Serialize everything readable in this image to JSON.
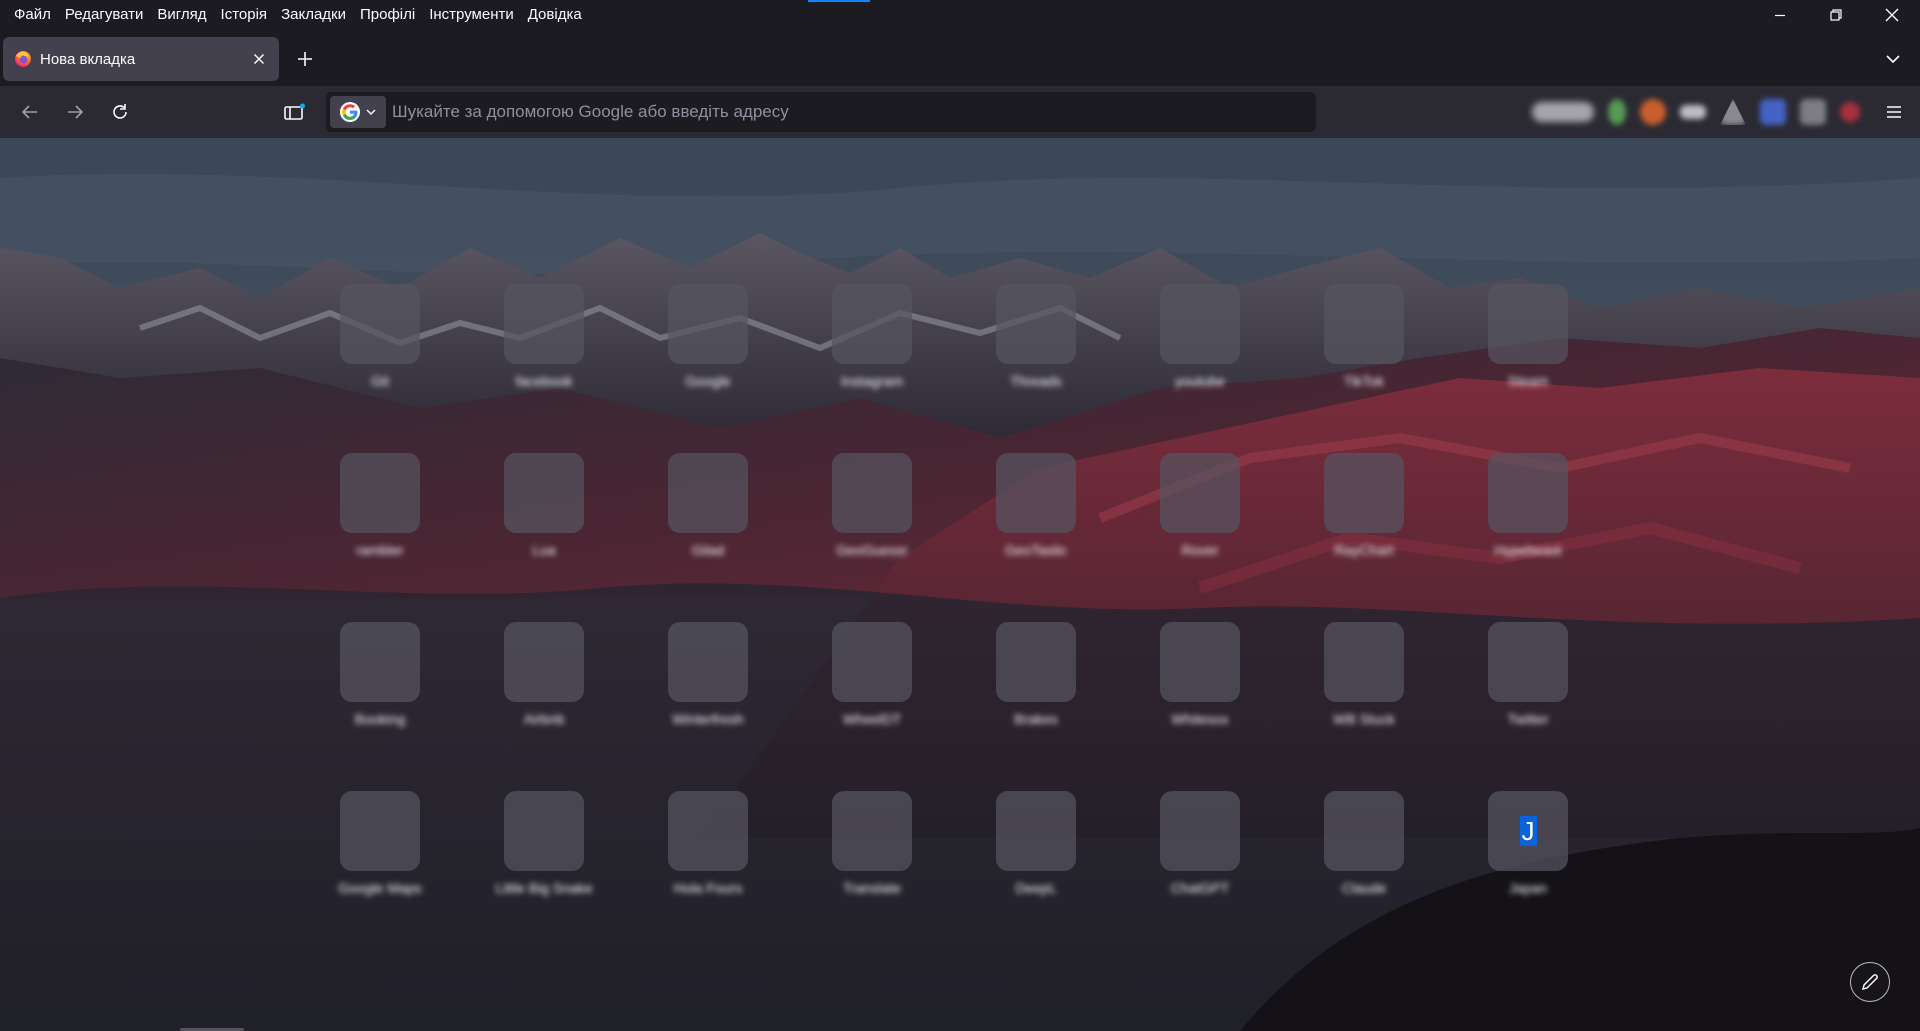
{
  "menu": {
    "items": [
      "Файл",
      "Редагувати",
      "Вигляд",
      "Історія",
      "Закладки",
      "Профілі",
      "Інструменти",
      "Довідка"
    ]
  },
  "window_controls": [
    "minimize-icon",
    "restore-icon",
    "close-icon"
  ],
  "tab": {
    "title": "Нова вкладка",
    "favicon": "firefox-icon"
  },
  "navbar": {
    "search_placeholder": "Шукайте за допомогою Google або введіть адресу",
    "engine": "google-icon",
    "extensions": [
      "vpn-extension-icon",
      "green-extension-icon",
      "orange-extension-icon",
      "mask-extension-icon",
      "warning-extension-icon",
      "translate-extension-icon",
      "puzzle-extension-icon",
      "red-extension-icon"
    ]
  },
  "shortcuts": [
    {
      "label": "Git"
    },
    {
      "label": "facebook"
    },
    {
      "label": "Google"
    },
    {
      "label": "Instagram"
    },
    {
      "label": "Threads"
    },
    {
      "label": "youtube"
    },
    {
      "label": "TikTok"
    },
    {
      "label": "Steam"
    },
    {
      "label": "rambler"
    },
    {
      "label": "Lua"
    },
    {
      "label": "Gilad"
    },
    {
      "label": "GeoGuessr"
    },
    {
      "label": "GeoTastic"
    },
    {
      "label": "Rover"
    },
    {
      "label": "RayChart"
    },
    {
      "label": "Hypebeast"
    },
    {
      "label": "Booking"
    },
    {
      "label": "Airbnb"
    },
    {
      "label": "Winterfresh"
    },
    {
      "label": "WheelDT"
    },
    {
      "label": "Brakes"
    },
    {
      "label": "Whitesox"
    },
    {
      "label": "WB Stuck"
    },
    {
      "label": "Twitter"
    },
    {
      "label": "Google Maps"
    },
    {
      "label": "Little Big Snake"
    },
    {
      "label": "Hola Fours"
    },
    {
      "label": "Translate"
    },
    {
      "label": "DeepL"
    },
    {
      "label": "ChatGPT"
    },
    {
      "label": "Claude"
    },
    {
      "label": "Japan",
      "letter": "J"
    }
  ],
  "colors": {
    "accent": "#0a84ff",
    "chrome_bg": "#1c1b22",
    "toolbar_bg": "#2b2a33",
    "tab_bg": "#42414d"
  }
}
